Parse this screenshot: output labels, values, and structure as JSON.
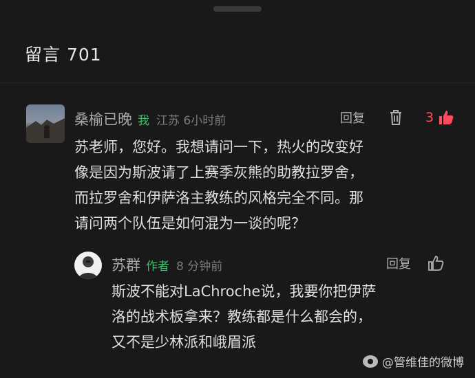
{
  "header": {
    "title": "留言 701"
  },
  "comment": {
    "username": "桑榆已晚",
    "tag": "我",
    "location_time": "江苏 6小时前",
    "reply_label": "回复",
    "like_count": "3",
    "content_lines": [
      "苏老师，您好。我想请问一下，热火的改变好",
      "像是因为斯波请了上赛季灰熊的助教拉罗舍，",
      "而拉罗舍和伊萨洛主教练的风格完全不同。那",
      "请问两个队伍是如何混为一谈的呢？"
    ]
  },
  "reply": {
    "username": "苏群",
    "tag": "作者",
    "time": "8 分钟前",
    "reply_label": "回复",
    "content_lines": [
      "斯波不能对LaChroche说，我要你把伊萨",
      "洛的战术板拿来？教练都是什么都会的，",
      "又不是少林派和峨眉派"
    ]
  },
  "watermark": {
    "text": "@管维佳的微博"
  },
  "colors": {
    "background": "#191919",
    "accent_green": "#3fbf6d",
    "like_red": "#ff4d5e"
  },
  "icons": [
    "trash-icon",
    "thumbs-up-icon",
    "weibo-icon"
  ]
}
